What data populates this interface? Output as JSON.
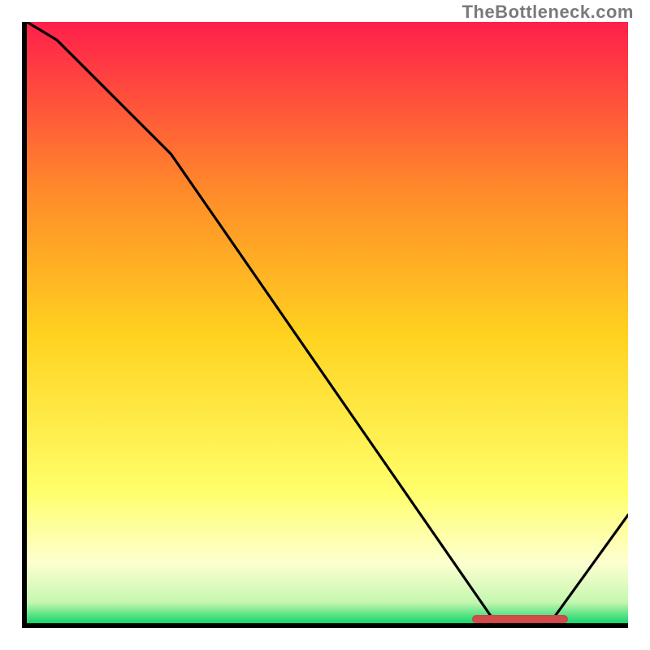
{
  "attribution": "TheBottleneck.com",
  "colors": {
    "gradient_top": "#ff1f4b",
    "gradient_mid_upper": "#ff8a2a",
    "gradient_mid": "#ffd21f",
    "gradient_mid_lower": "#ffff6a",
    "gradient_lower": "#fdffd0",
    "gradient_bottom": "#13d66a",
    "axis": "#000000",
    "curve": "#000000",
    "marker": "#d24a4a",
    "attribution_text": "#7a7a7a"
  },
  "chart_data": {
    "type": "line",
    "title": "",
    "xlabel": "",
    "ylabel": "",
    "xlim": [
      0,
      100
    ],
    "ylim": [
      0,
      100
    ],
    "x": [
      0,
      5,
      24,
      78,
      87,
      100
    ],
    "values": [
      102,
      97,
      78,
      0,
      0,
      18
    ],
    "marker_range_x": [
      74,
      90
    ],
    "note": "y-values are approximate readings of the black curve height as a percentage of the plot area; x is percentage across the plot width. The small red marker near the bottom spans roughly x=74..90 at y≈0."
  },
  "gradient_stops": [
    {
      "offset": 0.0,
      "color": "#ff1f4b"
    },
    {
      "offset": 0.28,
      "color": "#ff8a2a"
    },
    {
      "offset": 0.52,
      "color": "#ffd21f"
    },
    {
      "offset": 0.78,
      "color": "#ffff6a"
    },
    {
      "offset": 0.9,
      "color": "#fdffd0"
    },
    {
      "offset": 0.965,
      "color": "#c6f7b0"
    },
    {
      "offset": 1.0,
      "color": "#13d66a"
    }
  ]
}
